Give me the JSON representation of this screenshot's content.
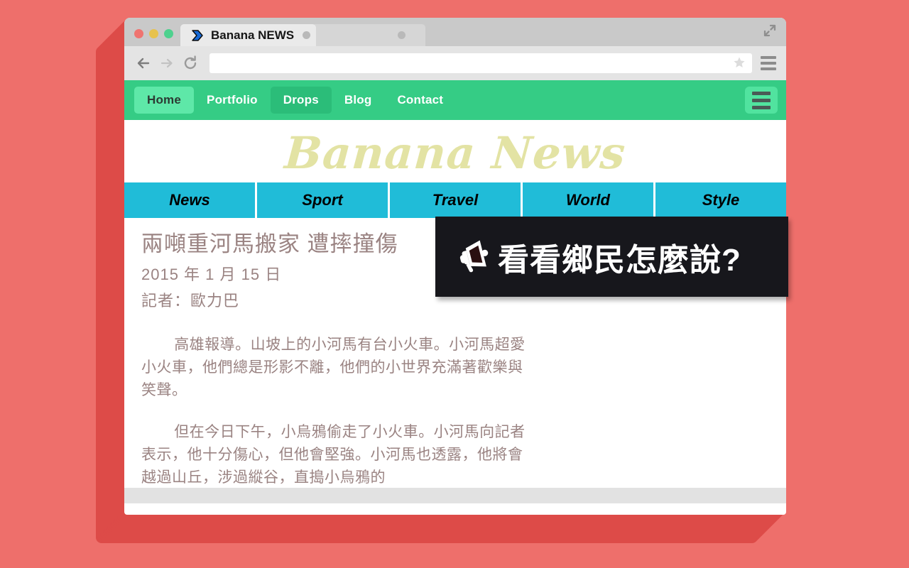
{
  "desktop": {
    "background_color": "#ee6f6b",
    "shadow_color": "#dd4b48"
  },
  "browser": {
    "window_controls": [
      {
        "name": "close",
        "color": "#ef7470"
      },
      {
        "name": "minimize",
        "color": "#e7c24d"
      },
      {
        "name": "maximize",
        "color": "#4ed18e"
      }
    ],
    "expand_icon": "expand-arrows-icon",
    "tabs": [
      {
        "title": "Banana NEWS",
        "active": true,
        "favicon": "blue-chevron-favicon",
        "close_icon": "close-dot-icon"
      },
      {
        "title": "",
        "active": false,
        "favicon": "",
        "close_icon": "close-dot-icon"
      }
    ],
    "toolbar": {
      "back_label": "←",
      "forward_label": "→",
      "reload_label": "↻",
      "back_icon": "back-arrow-icon",
      "forward_icon": "forward-arrow-icon",
      "reload_icon": "reload-icon",
      "address_value": "",
      "address_placeholder": "",
      "bookmark_icon": "star-icon",
      "menu_icon": "hamburger-menu-icon"
    }
  },
  "site_nav": {
    "background_color": "#35cc85",
    "items": [
      {
        "label": "Home",
        "state": "home"
      },
      {
        "label": "Portfolio",
        "state": "normal"
      },
      {
        "label": "Drops",
        "state": "active"
      },
      {
        "label": "Blog",
        "state": "normal"
      },
      {
        "label": "Contact",
        "state": "normal"
      }
    ],
    "menu_icon": "hamburger-menu-icon"
  },
  "site": {
    "logo_text": "Banana News",
    "logo_color": "#e3e3a4",
    "categories": [
      {
        "label": "News"
      },
      {
        "label": "Sport"
      },
      {
        "label": "Travel"
      },
      {
        "label": "World"
      },
      {
        "label": "Style"
      }
    ],
    "category_color": "#20bcd8"
  },
  "article": {
    "headline": "兩噸重河馬搬家 遭摔撞傷",
    "date": "2015 年 1 月 15 日",
    "author": "記者：歐力巴",
    "paragraphs": [
      "高雄報導。山坡上的小河馬有台小火車。小河馬超愛小火車，他們總是形影不離，他們的小世界充滿著歡樂與笑聲。",
      "但在今日下午，小烏鴉偷走了小火車。小河馬向記者表示，他十分傷心，但他會堅強。小河馬也透露，他將會越過山丘，涉過縱谷，直搗小烏鴉的"
    ],
    "text_color": "#9a8382"
  },
  "tooltip": {
    "text": "看看鄉民怎麼說?",
    "icon": "megaphone-icon",
    "background_color": "#17171c",
    "text_color": "#ffffff"
  }
}
